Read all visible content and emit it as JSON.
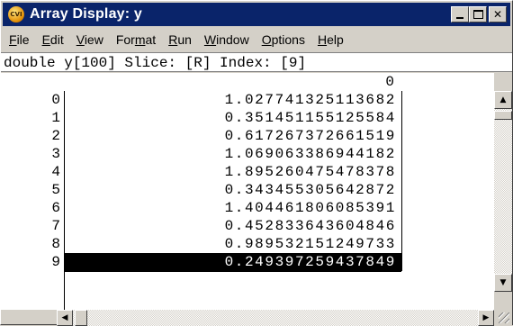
{
  "window": {
    "title": "Array Display: y",
    "app_icon_text": "CVI"
  },
  "menu": [
    "File",
    "Edit",
    "View",
    "Format",
    "Run",
    "Window",
    "Options",
    "Help"
  ],
  "menu_underline": [
    "F",
    "E",
    "V",
    "m",
    "R",
    "W",
    "O",
    "H"
  ],
  "info_line": "double y[100] Slice: [R] Index: [9]",
  "table": {
    "column_header": "0",
    "row_indices": [
      "0",
      "1",
      "2",
      "3",
      "4",
      "5",
      "6",
      "7",
      "8",
      "9"
    ],
    "values": [
      "1.027741325113682",
      "0.351451155125584",
      "0.617267372661519",
      "1.069063386944182",
      "1.895260475478378",
      "0.343455305642872",
      "1.404461806085391",
      "0.452833643604846",
      "0.989532151249733",
      "0.249397259437849"
    ],
    "selected_row": 9
  },
  "colors": {
    "titlebar": "#0a246a",
    "selection": "#000000",
    "face": "#d4d0c8"
  },
  "icons": {
    "scroll_up": "up-arrow-icon",
    "scroll_down": "down-arrow-icon",
    "scroll_left": "left-arrow-icon",
    "scroll_right": "right-arrow-icon"
  }
}
